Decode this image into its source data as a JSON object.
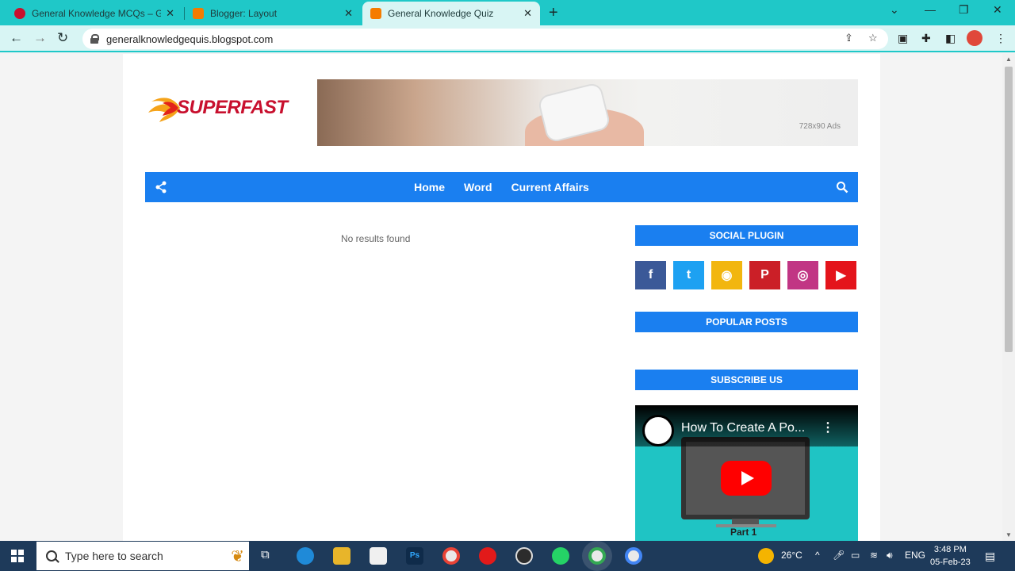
{
  "browser": {
    "tabs": [
      {
        "label": "General Knowledge MCQs – GK I",
        "favicon_color": "#c8102e",
        "active": false
      },
      {
        "label": "Blogger: Layout",
        "favicon_color": "#f57c00",
        "active": false
      },
      {
        "label": "General Knowledge Quiz",
        "favicon_color": "#f57c00",
        "active": true
      }
    ],
    "url": "generalknowledgequis.blogspot.com"
  },
  "site": {
    "logo_text": "SUPERFAST",
    "ad_label": "728x90 Ads",
    "nav": [
      "Home",
      "Word",
      "Current Affairs"
    ],
    "no_results": "No results found",
    "widgets": {
      "social_title": "SOCIAL PLUGIN",
      "popular_title": "POPULAR POSTS",
      "subscribe_title": "SUBSCRIBE US"
    },
    "social_buttons": [
      {
        "name": "facebook",
        "glyph": "f",
        "color": "#3b5998"
      },
      {
        "name": "twitter",
        "glyph": "t",
        "color": "#1da1f2"
      },
      {
        "name": "rss",
        "glyph": "◉",
        "color": "#f2b60f"
      },
      {
        "name": "pinterest",
        "glyph": "P",
        "color": "#cb1f27"
      },
      {
        "name": "instagram",
        "glyph": "◎",
        "color": "#c13584"
      },
      {
        "name": "youtube",
        "glyph": "▶",
        "color": "#e4141b"
      }
    ],
    "video": {
      "title": "How To Create A Po...",
      "caption": "Part 1"
    }
  },
  "taskbar": {
    "search_placeholder": "Type here to search",
    "temperature": "26°C",
    "language": "ENG",
    "time": "3:48 PM",
    "date": "05-Feb-23"
  },
  "colors": {
    "tabstrip": "#1fc8c8",
    "nav_blue": "#1a7ff0",
    "logo_red": "#c8102e"
  }
}
